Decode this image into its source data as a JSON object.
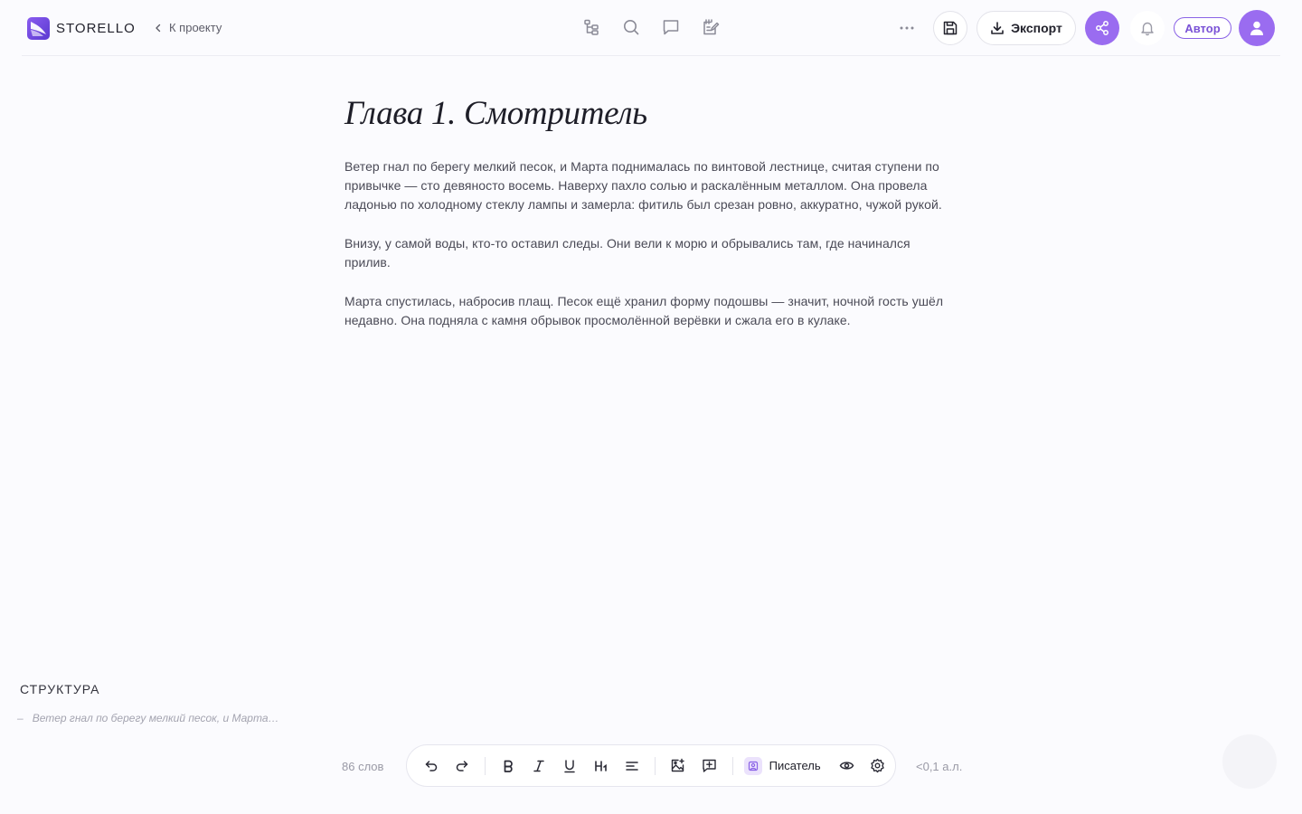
{
  "header": {
    "brand": "STORELLO",
    "back_label": "К проекту",
    "center_tools": [
      "structure-icon",
      "search-icon",
      "comment-icon",
      "notes-icon"
    ],
    "export_label": "Экспорт",
    "role_badge": "Автор"
  },
  "document": {
    "title": "Глава 1. Смотритель",
    "paragraphs": [
      "Ветер гнал по берегу мелкий песок, и Марта поднималась по винтовой лестнице, считая ступени по привычке — сто девяносто восемь. Наверху пахло солью и раскалённым металлом. Она провела ладонью по холодному стеклу лампы и замерла: фитиль был срезан ровно, аккуратно, чужой рукой.",
      "Внизу, у самой воды, кто-то оставил следы. Они вели к морю и обрывались там, где начинался прилив.",
      "Марта спустилась, набросив плащ. Песок ещё хранил форму подошвы — значит, ночной гость ушёл недавно. Она подняла с камня обрывок просмолённой верёвки и сжала его в кулаке."
    ]
  },
  "structure": {
    "title": "СТРУКТУРА",
    "items": [
      {
        "bullet": "–",
        "text": "Ветер гнал по берегу мелкий песок, и Марта…"
      }
    ]
  },
  "footer": {
    "word_count": "86 слов",
    "volume": "<0,1 а.л.",
    "mode_label": "Писатель"
  },
  "colors": {
    "accent": "#9a6cf0",
    "background": "#fbfbfe"
  }
}
